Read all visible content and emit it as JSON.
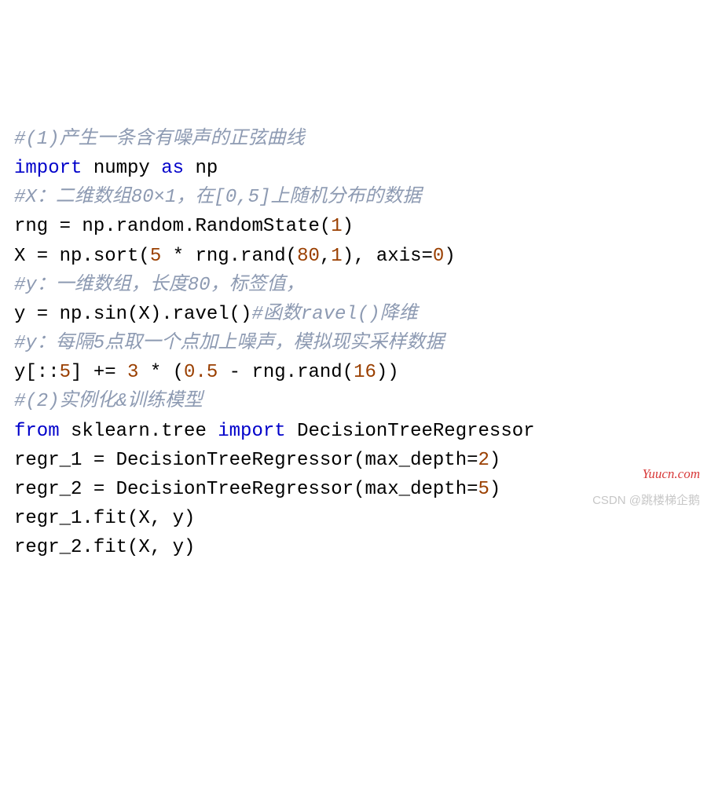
{
  "lines": {
    "l1": "#(1)产生一条含有噪声的正弦曲线",
    "l2a": "import",
    "l2b": " numpy ",
    "l2c": "as",
    "l2d": " np",
    "l3": "#X：二维数组80×1，在[0,5]上随机分布的数据",
    "l4a": "rng = np.random.RandomState(",
    "l4b": "1",
    "l4c": ")",
    "l5a": "X = np.sort(",
    "l5b": "5",
    "l5c": " * rng.rand(",
    "l5d": "80",
    "l5e": ",",
    "l5f": "1",
    "l5g": "), axis=",
    "l5h": "0",
    "l5i": ")",
    "l6": "#y：一维数组，长度80，标签值，",
    "l7a": "y = np.sin(X).ravel()",
    "l7b": "#函数ravel()降维",
    "l8": "#y：每隔5点取一个点加上噪声，模拟现实采样数据",
    "l9a": "y[::",
    "l9b": "5",
    "l9c": "] += ",
    "l9d": "3",
    "l9e": " * (",
    "l9f": "0.5",
    "l9g": " - rng.rand(",
    "l9h": "16",
    "l9i": "))",
    "l10": "#(2)实例化&训练模型",
    "l11a": "from",
    "l11b": " sklearn.tree ",
    "l11c": "import",
    "l11d": " DecisionTreeRegressor",
    "l12a": "regr_1 = DecisionTreeRegressor(max_depth=",
    "l12b": "2",
    "l12c": ")",
    "l13a": "regr_2 = DecisionTreeRegressor(max_depth=",
    "l13b": "5",
    "l13c": ")",
    "l14": "regr_1.fit(X, y)",
    "l15": "regr_2.fit(X, y)"
  },
  "watermarks": {
    "w1": "Yuucn.com",
    "w2": "CSDN @跳楼梯企鹅"
  }
}
